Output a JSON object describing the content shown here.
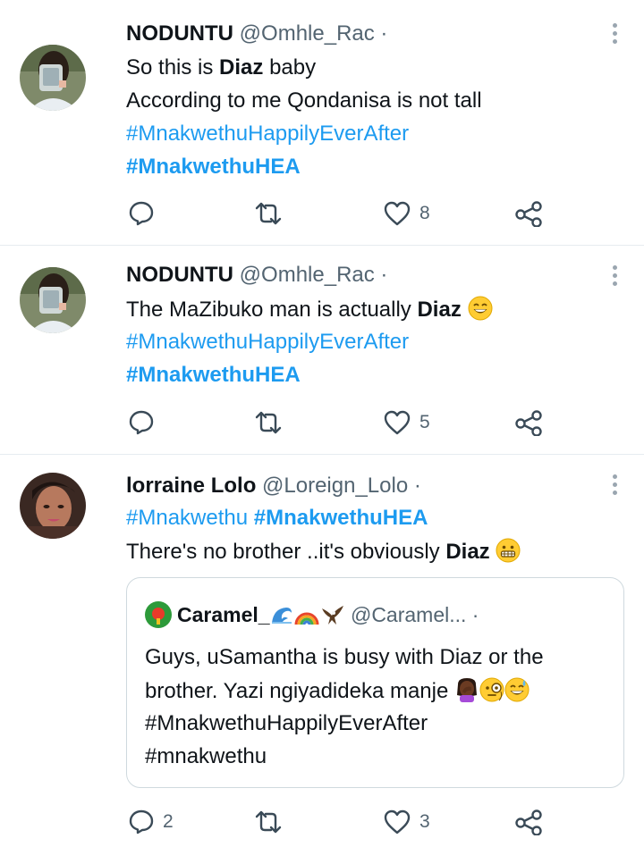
{
  "tweets": [
    {
      "name": "NODUNTU",
      "handle": "@Omhle_Rac",
      "dot": "·",
      "lines": [
        [
          {
            "t": "So this is "
          },
          {
            "t": "Diaz",
            "b": true
          },
          {
            "t": " baby"
          }
        ],
        [
          {
            "t": "According to me Qondanisa is not tall"
          }
        ],
        [
          {
            "t": "#MnakwethuHappilyEverAfter",
            "tag": true
          }
        ],
        [
          {
            "t": "#MnakwethuHEA",
            "tag": true,
            "b": true
          }
        ]
      ],
      "actions": {
        "reply_count": "",
        "retweet_count": "",
        "like_count": "8"
      }
    },
    {
      "name": "NODUNTU",
      "handle": "@Omhle_Rac",
      "dot": "·",
      "lines": [
        [
          {
            "t": "The MaZibuko man is actually "
          },
          {
            "t": "Diaz",
            "b": true
          },
          {
            "emoji": "grinning-squint-face"
          }
        ],
        [
          {
            "t": "#MnakwethuHappilyEverAfter",
            "tag": true
          }
        ],
        [
          {
            "t": "#MnakwethuHEA",
            "tag": true,
            "b": true
          }
        ]
      ],
      "actions": {
        "reply_count": "",
        "retweet_count": "",
        "like_count": "5"
      }
    },
    {
      "name": "lorraine Lolo",
      "handle": "@Loreign_Lolo",
      "dot": "·",
      "lines": [
        [
          {
            "t": "#Mnakwethu",
            "tag": true
          },
          {
            "t": " "
          },
          {
            "t": "#MnakwethuHEA",
            "tag": true,
            "b": true
          }
        ],
        [
          {
            "t": "There's no brother ..it's obviously "
          },
          {
            "t": "Diaz",
            "b": true
          },
          {
            "t": " "
          },
          {
            "emoji": "grimacing-face"
          }
        ]
      ],
      "quote": {
        "name": "Caramel_",
        "name_emojis": [
          "wave-icon",
          "rainbow-icon",
          "eagle-icon"
        ],
        "handle": "@Caramel...",
        "dot": "·",
        "lines": [
          [
            {
              "t": "Guys, uSamantha is busy with Diaz or the"
            }
          ],
          [
            {
              "t": "brother. Yazi ngiyadideka manje "
            },
            {
              "emoji": "person-facepalming"
            },
            {
              "emoji": "face-with-monocle"
            },
            {
              "emoji": "grinning-sweat"
            }
          ],
          [
            {
              "t": "#MnakwethuHappilyEverAfter"
            }
          ],
          [
            {
              "t": "#mnakwethu"
            }
          ]
        ]
      },
      "actions": {
        "reply_count": "2",
        "retweet_count": "",
        "like_count": "3"
      }
    }
  ],
  "colors": {
    "link": "#1d9bf0",
    "text": "#0f1419",
    "secondary": "#536471",
    "divider": "#e6ecf0"
  }
}
